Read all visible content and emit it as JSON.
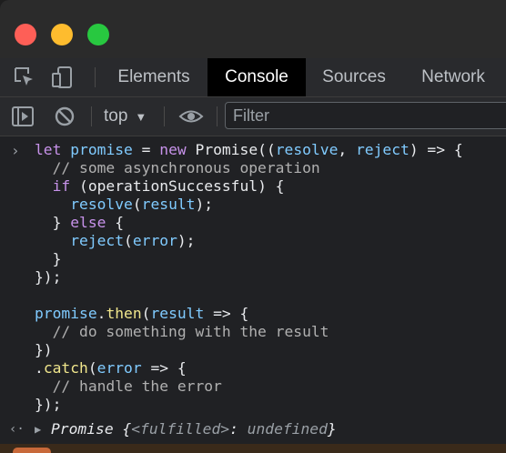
{
  "devtools": {
    "tabs": [
      {
        "label": "Elements",
        "active": false
      },
      {
        "label": "Console",
        "active": true
      },
      {
        "label": "Sources",
        "active": false
      },
      {
        "label": "Network",
        "active": false
      }
    ],
    "toolbar": {
      "context": "top",
      "filter_placeholder": "Filter"
    }
  },
  "console": {
    "input_lines": [
      "let promise = new Promise((resolve, reject) => {",
      "  // some asynchronous operation",
      "  if (operationSuccessful) {",
      "    resolve(result);",
      "  } else {",
      "    reject(error);",
      "  }",
      "});",
      "",
      "promise.then(result => {",
      "  // do something with the result",
      "})",
      ".catch(error => {",
      "  // handle the error",
      "});"
    ],
    "result": {
      "type": "Promise",
      "state_key": "<fulfilled>",
      "state_value": "undefined"
    }
  },
  "icons": [
    "inspect-element-icon",
    "device-toolbar-icon",
    "sidebar-toggle-icon",
    "clear-console-icon",
    "eye-icon"
  ],
  "colors": {
    "close": "#fe5f57",
    "minimize": "#febc2e",
    "zoom": "#28c840",
    "keyword": "#c792ea",
    "identifier": "#80cbff",
    "method": "#f0e68c"
  }
}
